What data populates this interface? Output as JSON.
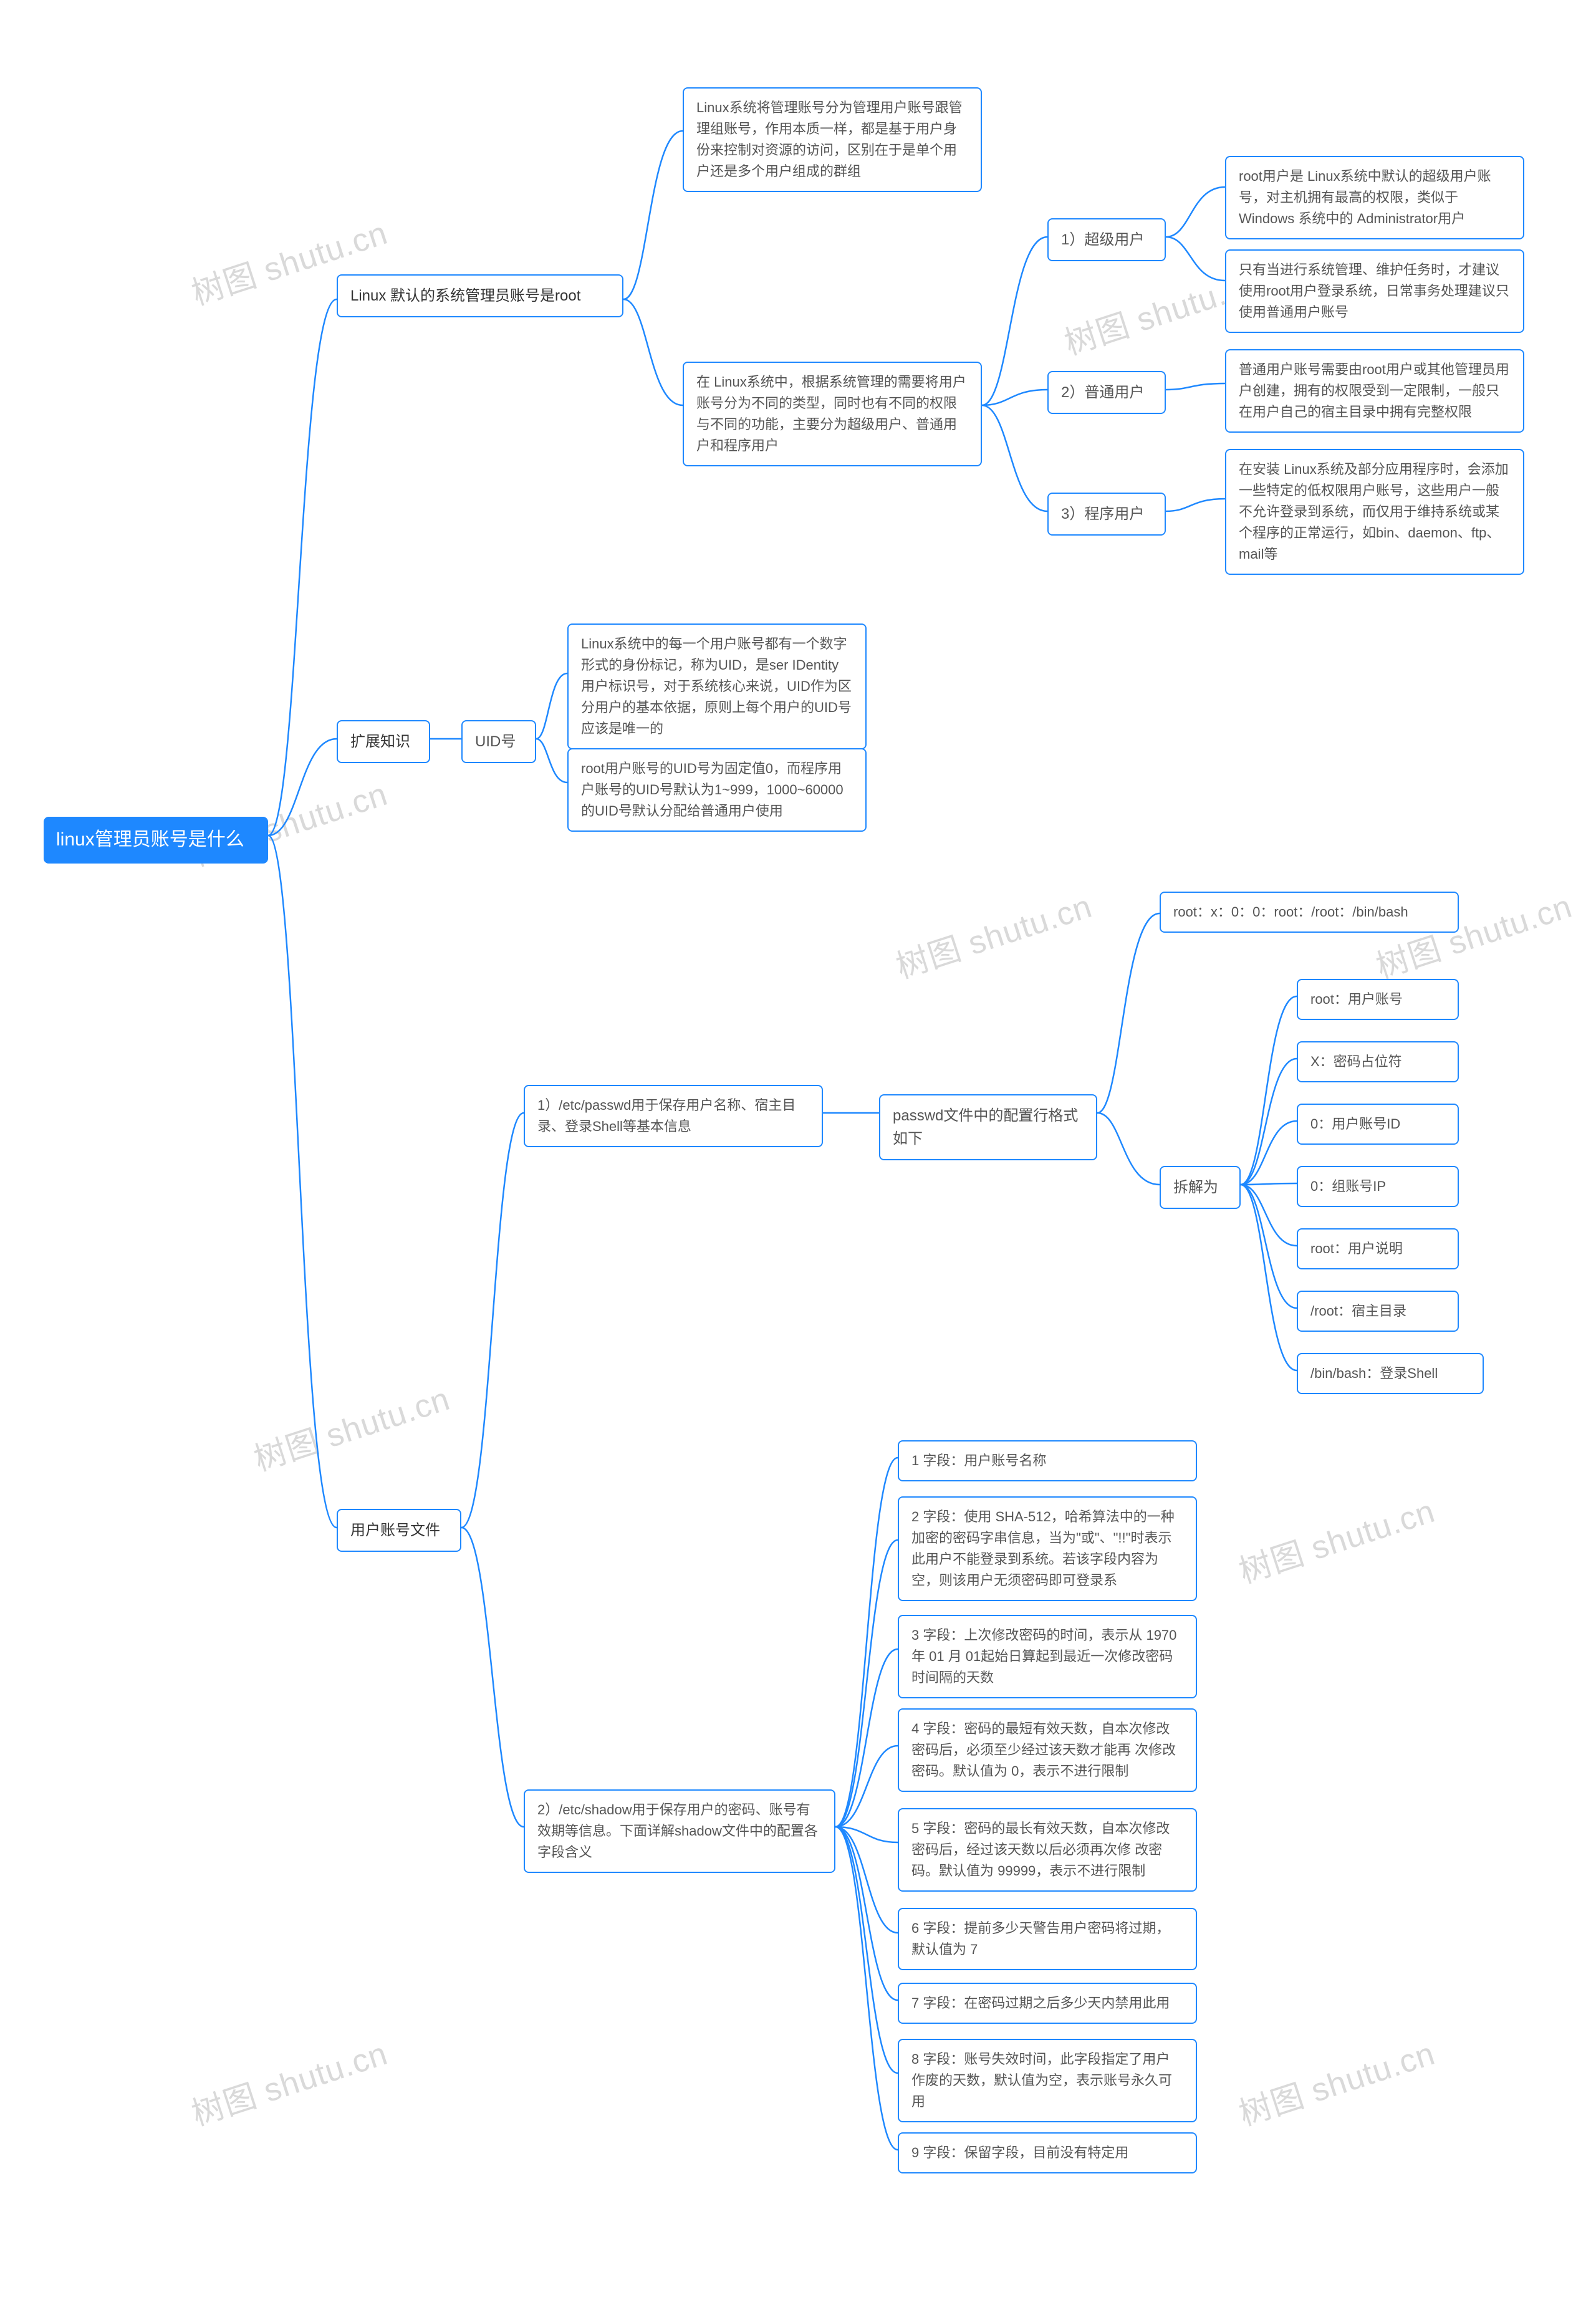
{
  "watermark": "树图 shutu.cn",
  "root": {
    "text": "linux管理员账号是什么"
  },
  "a1": {
    "title": "Linux 默认的系统管理员账号是root",
    "c1": "Linux系统将管理账号分为管理用户账号跟管理组账号，作用本质一样，都是基于用户身份来控制对资源的访问，区别在于是单个用户还是多个用户组成的群组",
    "c2": "在 Linux系统中，根据系统管理的需要将用户账号分为不同的类型，同时也有不同的权限与不同的功能，主要分为超级用户、普通用户和程序用户",
    "u1": {
      "label": "1）超级用户",
      "d1": "root用户是 Linux系统中默认的超级用户账号，对主机拥有最高的权限，类似于 Windows 系统中的 Administrator用户",
      "d2": "只有当进行系统管理、维护任务时，才建议使用root用户登录系统，日常事务处理建议只使用普通用户账号"
    },
    "u2": {
      "label": "2）普通用户",
      "d": "普通用户账号需要由root用户或其他管理员用户创建，拥有的权限受到一定限制，一般只在用户自己的宿主目录中拥有完整权限"
    },
    "u3": {
      "label": "3）程序用户",
      "d": "在安装 Linux系统及部分应用程序时，会添加一些特定的低权限用户账号，这些用户一般不允许登录到系统，而仅用于维持系统或某个程序的正常运行，如bin、daemon、ftp、mail等"
    }
  },
  "a2": {
    "title": "扩展知识",
    "uid": "UID号",
    "d1": "Linux系统中的每一个用户账号都有一个数字形式的身份标记，称为UID，是ser IDentity 用户标识号，对于系统核心来说，UID作为区分用户的基本依据，原则上每个用户的UID号应该是唯一的",
    "d2": "root用户账号的UID号为固定值0，而程序用户账号的UID号默认为1~999，1000~60000 的UID号默认分配给普通用户使用"
  },
  "a3": {
    "title": "用户账号文件",
    "f1": {
      "label": "1）/etc/passwd用于保存用户名称、宿主目录、登录Shell等基本信息",
      "fmt": "passwd文件中的配置行格式如下",
      "sample": "root：x：0：0：root：/root：/bin/bash",
      "split": "拆解为",
      "p1": "root：用户账号",
      "p2": "X：密码占位符",
      "p3": "0：用户账号ID",
      "p4": "0：组账号IP",
      "p5": "root：用户说明",
      "p6": "/root：宿主目录",
      "p7": "/bin/bash：登录Shell"
    },
    "f2": {
      "label": "2）/etc/shadow用于保存用户的密码、账号有效期等信息。下面详解shadow文件中的配置各字段含义",
      "s1": "1 字段：用户账号名称",
      "s2": "2 字段：使用 SHA-512，哈希算法中的一种加密的密码字串信息，当为\"或\"、\"!!\"时表示此用户不能登录到系统。若该字段内容为空，则该用户无须密码即可登录系",
      "s3": "3 字段：上次修改密码的时间，表示从 1970 年 01 月 01起始日算起到最近一次修改密码时间隔的天数",
      "s4": "4 字段：密码的最短有效天数，自本次修改密码后，必须至少经过该天数才能再 次修改密码。默认值为 0，表示不进行限制",
      "s5": "5 字段：密码的最长有效天数，自本次修改密码后，经过该天数以后必须再次修 改密码。默认值为 99999，表示不进行限制",
      "s6": "6 字段：提前多少天警告用户密码将过期，默认值为 7",
      "s7": "7 字段：在密码过期之后多少天内禁用此用",
      "s8": "8 字段：账号失效时间，此字段指定了用户作废的天数，默认值为空，表示账号永久可用",
      "s9": "9 字段：保留字段，目前没有特定用"
    }
  }
}
